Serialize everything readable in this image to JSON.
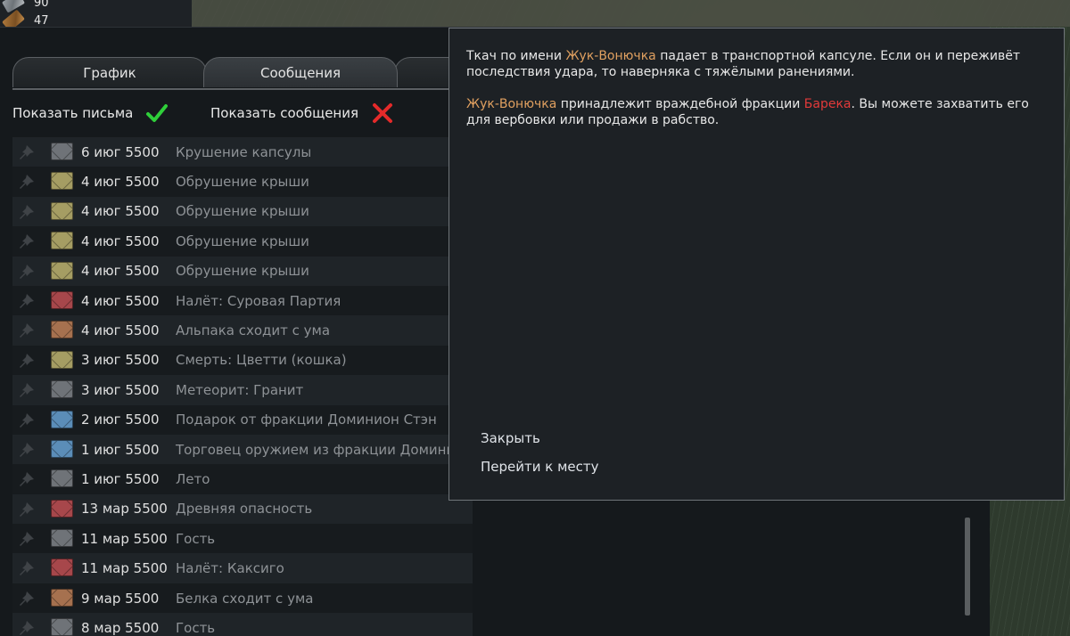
{
  "resources": [
    {
      "icon": "steel-icon",
      "value": "90"
    },
    {
      "icon": "wood-icon",
      "value": "47"
    }
  ],
  "tabs": [
    {
      "label": "График"
    },
    {
      "label": "Сообщения"
    },
    {
      "label": ""
    }
  ],
  "toggles": {
    "letters": {
      "label": "Показать письма",
      "state": "on",
      "icon": "checkmark-icon"
    },
    "messages": {
      "label": "Показать сообщения",
      "state": "off",
      "icon": "cross-icon"
    }
  },
  "colors": {
    "gray": "#6f7378",
    "yellow": "#a59d63",
    "red": "#a7474b",
    "orange": "#a6714f",
    "blue": "#5b8db8"
  },
  "letters": [
    {
      "date": "6 июг 5500",
      "title": "Крушение капсулы",
      "color": "gray"
    },
    {
      "date": "4 июг 5500",
      "title": "Обрушение крыши",
      "color": "yellow"
    },
    {
      "date": "4 июг 5500",
      "title": "Обрушение крыши",
      "color": "yellow"
    },
    {
      "date": "4 июг 5500",
      "title": "Обрушение крыши",
      "color": "yellow"
    },
    {
      "date": "4 июг 5500",
      "title": "Обрушение крыши",
      "color": "yellow"
    },
    {
      "date": "4 июг 5500",
      "title": "Налёт: Суровая Партия",
      "color": "red"
    },
    {
      "date": "4 июг 5500",
      "title": "Альпака сходит с ума",
      "color": "orange"
    },
    {
      "date": "3 июг 5500",
      "title": "Смерть: Цветти (кошка)",
      "color": "yellow"
    },
    {
      "date": "3 июг 5500",
      "title": "Метеорит: Гранит",
      "color": "gray"
    },
    {
      "date": "2 июг 5500",
      "title": "Подарок от фракции Доминион Стэн",
      "color": "blue"
    },
    {
      "date": "1 июг 5500",
      "title": "Торговец оружием из фракции Доминион",
      "color": "blue"
    },
    {
      "date": "1 июг 5500",
      "title": "Лето",
      "color": "gray"
    },
    {
      "date": "13 мар 5500",
      "title": "Древняя опасность",
      "color": "red"
    },
    {
      "date": "11 мар 5500",
      "title": "Гость",
      "color": "gray"
    },
    {
      "date": "11 мар 5500",
      "title": "Налёт: Каксиго",
      "color": "red"
    },
    {
      "date": "9 мар 5500",
      "title": "Белка сходит с ума",
      "color": "orange"
    },
    {
      "date": "8 мар 5500",
      "title": "Гость",
      "color": "gray"
    }
  ],
  "popup": {
    "p1_a": "Ткач по имени ",
    "p1_name": "Жук-Вонючка",
    "p1_b": " падает в транспортной капсуле. Если он и переживёт последствия удара, то наверняка с тяжёлыми ранениями.",
    "p2_name": "Жук-Вонючка",
    "p2_a": " принадлежит враждебной фракции ",
    "p2_faction": "Барека",
    "p2_b": ". Вы можете захватить его для вербовки или продажи в рабство.",
    "close_label": "Закрыть",
    "jump_label": "Перейти к месту"
  }
}
